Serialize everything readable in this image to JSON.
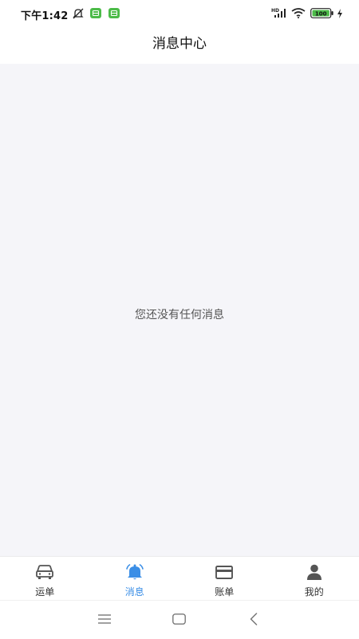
{
  "status_bar": {
    "time": "下午1:42",
    "signal_label": "HD",
    "battery_level": "100",
    "icons": [
      "mute-icon",
      "app-notification-icon",
      "app-notification-icon",
      "signal-icon",
      "wifi-icon",
      "battery-icon",
      "charging-icon"
    ]
  },
  "header": {
    "title": "消息中心"
  },
  "main": {
    "empty_text": "您还没有任何消息"
  },
  "tabbar": {
    "active_color": "#3a8ee6",
    "items": [
      {
        "label": "运单",
        "icon": "car-icon"
      },
      {
        "label": "消息",
        "icon": "bell-icon"
      },
      {
        "label": "账单",
        "icon": "card-icon"
      },
      {
        "label": "我的",
        "icon": "user-icon"
      }
    ]
  },
  "system_nav": {
    "icons": [
      "menu-icon",
      "home-icon",
      "back-icon"
    ]
  }
}
